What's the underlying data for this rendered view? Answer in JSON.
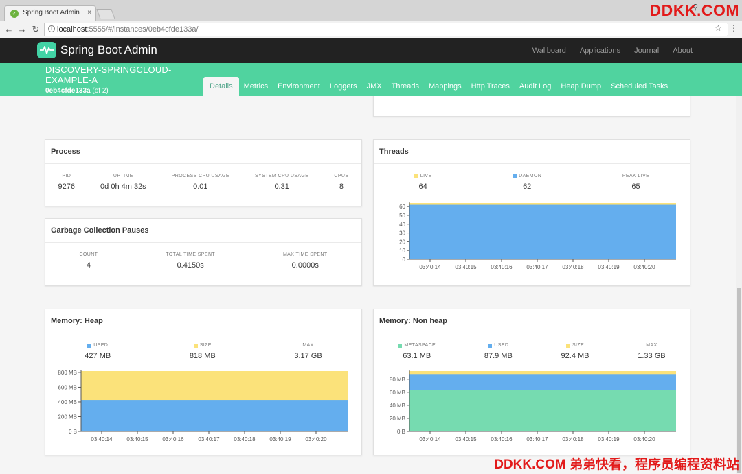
{
  "browser": {
    "tab_title": "Spring Boot Admin",
    "tab_close": "×",
    "url_host": "localhost",
    "url_path": ":5555/#/instances/0eb4cfde133a/",
    "watermark_top": "DDKK.COM"
  },
  "navbar": {
    "brand": "Spring Boot Admin",
    "links": [
      "Wallboard",
      "Applications",
      "Journal",
      "About"
    ]
  },
  "instance": {
    "name": "DISCOVERY-SPRINGCLOUD-EXAMPLE-A",
    "id": "0eb4cfde133a",
    "count": "(of 2)"
  },
  "tabs": [
    "Details",
    "Metrics",
    "Environment",
    "Loggers",
    "JMX",
    "Threads",
    "Mappings",
    "Http Traces",
    "Audit Log",
    "Heap Dump",
    "Scheduled Tasks"
  ],
  "active_tab": "Details",
  "colors": {
    "accent": "#50d39f",
    "navbar": "#222222",
    "blue": "#64aeee",
    "yellow": "#fbe27a",
    "teal": "#76dbb0"
  },
  "process": {
    "title": "Process",
    "labels": [
      "PID",
      "UPTIME",
      "PROCESS CPU USAGE",
      "SYSTEM CPU USAGE",
      "CPUS"
    ],
    "values": [
      "9276",
      "0d 0h 4m 32s",
      "0.01",
      "0.31",
      "8"
    ]
  },
  "gc": {
    "title": "Garbage Collection Pauses",
    "labels": [
      "COUNT",
      "TOTAL TIME SPENT",
      "MAX TIME SPENT"
    ],
    "values": [
      "4",
      "0.4150s",
      "0.0000s"
    ]
  },
  "threads": {
    "title": "Threads",
    "labels": [
      "LIVE",
      "DAEMON",
      "PEAK LIVE"
    ],
    "values": [
      "64",
      "62",
      "65"
    ]
  },
  "heap": {
    "title": "Memory: Heap",
    "labels": [
      "USED",
      "SIZE",
      "MAX"
    ],
    "values": [
      "427 MB",
      "818 MB",
      "3.17 GB"
    ]
  },
  "nonheap": {
    "title": "Memory: Non heap",
    "labels": [
      "METASPACE",
      "USED",
      "SIZE",
      "MAX"
    ],
    "values": [
      "63.1 MB",
      "87.9 MB",
      "92.4 MB",
      "1.33 GB"
    ]
  },
  "chart_data": [
    {
      "type": "area",
      "title": "Threads",
      "x": [
        "03:40:14",
        "03:40:15",
        "03:40:16",
        "03:40:17",
        "03:40:18",
        "03:40:19",
        "03:40:20"
      ],
      "yticks": [
        "0",
        "10",
        "20",
        "30",
        "40",
        "50",
        "60"
      ],
      "ylim": [
        0,
        64
      ],
      "series": [
        {
          "name": "LIVE",
          "values": [
            64,
            64,
            64,
            64,
            64,
            64,
            64
          ]
        },
        {
          "name": "DAEMON",
          "values": [
            62,
            62,
            62,
            62,
            62,
            62,
            62
          ]
        }
      ]
    },
    {
      "type": "area",
      "title": "Memory: Heap",
      "x": [
        "03:40:14",
        "03:40:15",
        "03:40:16",
        "03:40:17",
        "03:40:18",
        "03:40:19",
        "03:40:20"
      ],
      "yticks": [
        "0 B",
        "200 MB",
        "400 MB",
        "600 MB",
        "800 MB"
      ],
      "ylim": [
        0,
        818
      ],
      "series": [
        {
          "name": "SIZE",
          "values": [
            818,
            818,
            818,
            818,
            818,
            818,
            818
          ]
        },
        {
          "name": "USED",
          "values": [
            427,
            427,
            427,
            427,
            427,
            427,
            427
          ]
        }
      ]
    },
    {
      "type": "area",
      "title": "Memory: Non heap",
      "x": [
        "03:40:14",
        "03:40:15",
        "03:40:16",
        "03:40:17",
        "03:40:18",
        "03:40:19",
        "03:40:20"
      ],
      "yticks": [
        "0 B",
        "20 MB",
        "40 MB",
        "60 MB",
        "80 MB"
      ],
      "ylim": [
        0,
        92.4
      ],
      "series": [
        {
          "name": "SIZE",
          "values": [
            92.4,
            92.4,
            92.4,
            92.4,
            92.4,
            92.4,
            92.4
          ]
        },
        {
          "name": "USED",
          "values": [
            87.9,
            87.9,
            87.9,
            87.9,
            87.9,
            87.9,
            87.9
          ]
        },
        {
          "name": "METASPACE",
          "values": [
            63.1,
            63.1,
            63.1,
            63.1,
            63.1,
            63.1,
            63.1
          ]
        }
      ]
    }
  ],
  "watermark_bottom": "DDKK.COM 弟弟快看，程序员编程资料站"
}
